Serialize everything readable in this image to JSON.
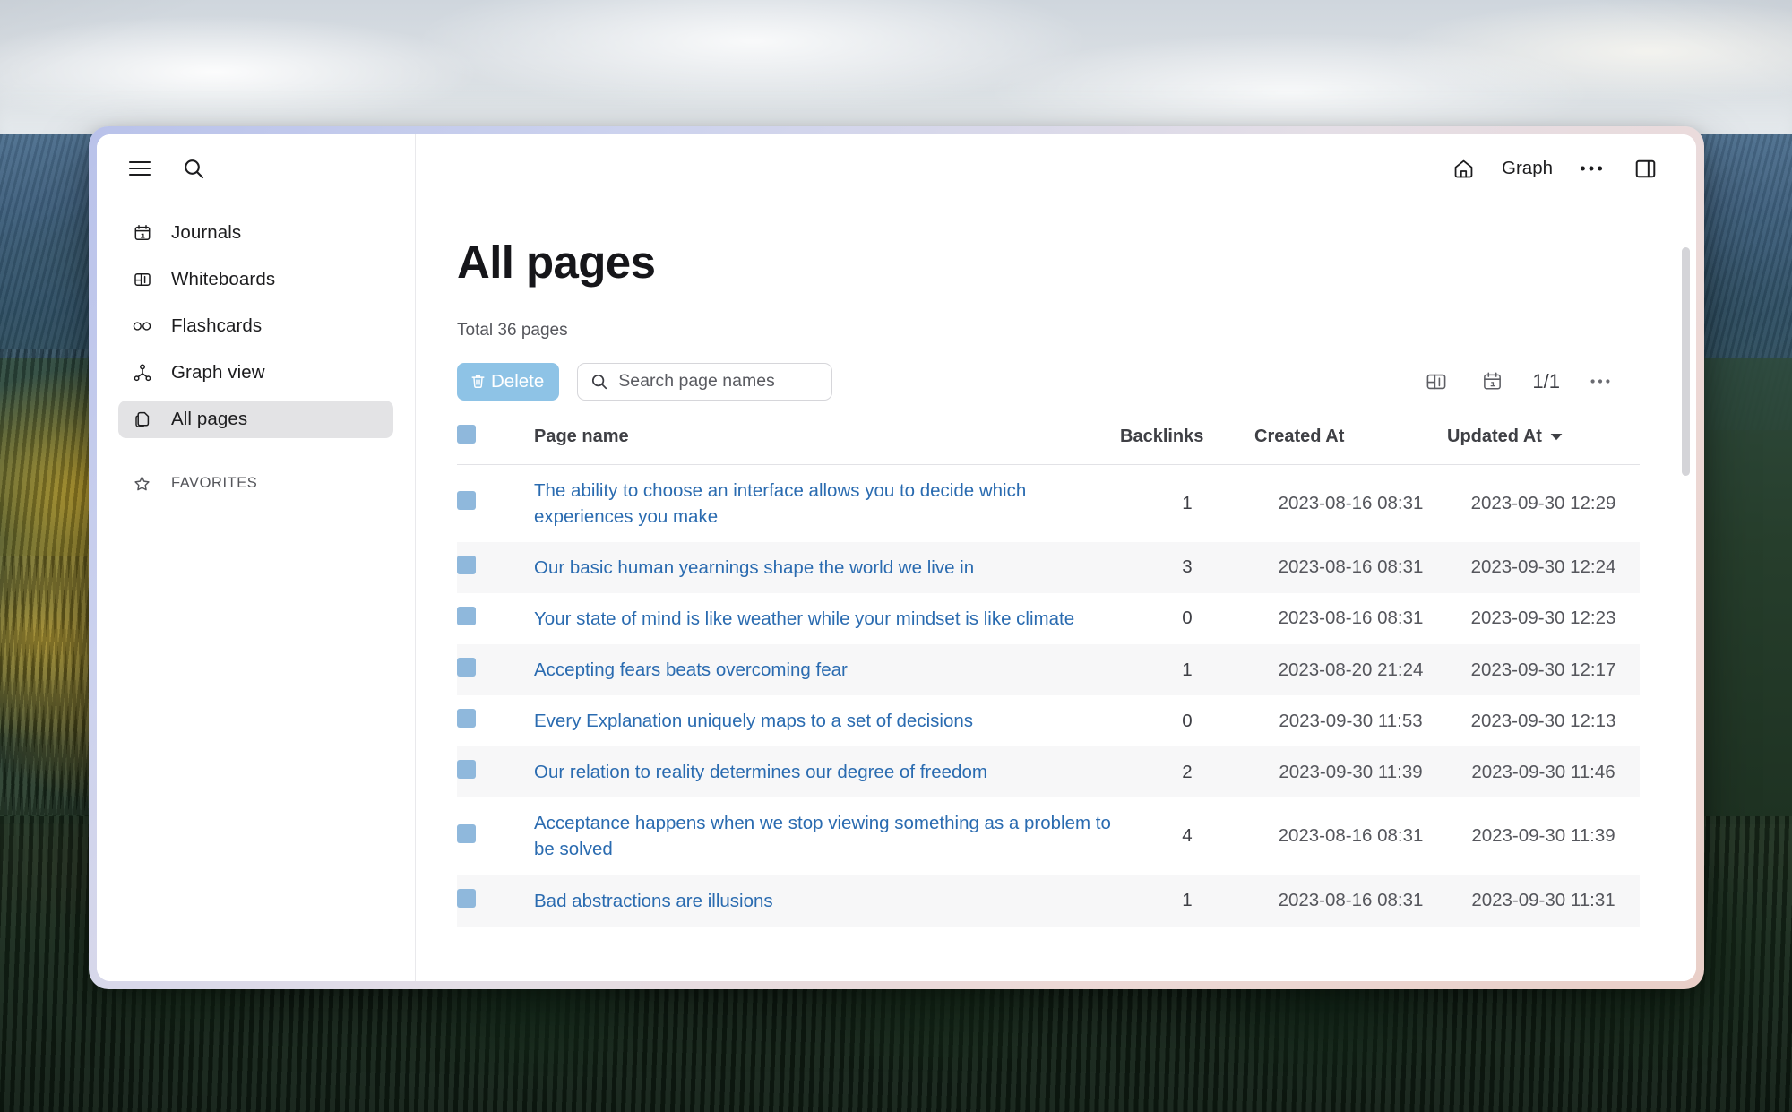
{
  "sidebar": {
    "menu_icon": "hamburger-menu-icon",
    "search_icon": "search-icon",
    "items": [
      {
        "label": "Journals",
        "icon": "calendar-icon",
        "active": false
      },
      {
        "label": "Whiteboards",
        "icon": "whiteboard-icon",
        "active": false
      },
      {
        "label": "Flashcards",
        "icon": "infinity-icon",
        "active": false
      },
      {
        "label": "Graph view",
        "icon": "graph-icon",
        "active": false
      },
      {
        "label": "All pages",
        "icon": "pages-icon",
        "active": true
      }
    ],
    "favorites_label": "FAVORITES",
    "favorites_icon": "star-icon"
  },
  "header": {
    "home_icon": "home-icon",
    "graph_label": "Graph",
    "more_icon": "ellipsis-icon",
    "right_sidebar_icon": "right-sidebar-toggle-icon"
  },
  "main": {
    "title": "All pages",
    "total": "Total 36 pages"
  },
  "toolbar": {
    "delete_label": "Delete",
    "delete_icon": "trash-icon",
    "delete_color": "#8ec3e6",
    "search_placeholder": "Search page names",
    "search_value": "",
    "search_icon": "search-icon",
    "whiteboard_icon": "whiteboard-icon",
    "calendar_icon": "calendar-icon",
    "pagination": "1/1",
    "more_icon": "ellipsis-icon"
  },
  "table": {
    "columns": {
      "page_name": "Page name",
      "backlinks": "Backlinks",
      "created_at": "Created At",
      "updated_at": "Updated At"
    },
    "sort_column": "Updated At",
    "sort_direction": "desc",
    "sort_icon": "chevron-down-icon",
    "checkbox_color": "#8fb8dc",
    "link_color": "#2a6bb0",
    "rows": [
      {
        "name": "The ability to choose an interface allows you to decide which experiences you make",
        "backlinks": "1",
        "created_at": "2023-08-16 08:31",
        "updated_at": "2023-09-30 12:29"
      },
      {
        "name": "Our basic human yearnings shape the world we live in",
        "backlinks": "3",
        "created_at": "2023-08-16 08:31",
        "updated_at": "2023-09-30 12:24"
      },
      {
        "name": "Your state of mind is like weather while your mindset is like climate",
        "backlinks": "0",
        "created_at": "2023-08-16 08:31",
        "updated_at": "2023-09-30 12:23"
      },
      {
        "name": "Accepting fears beats overcoming fear",
        "backlinks": "1",
        "created_at": "2023-08-20 21:24",
        "updated_at": "2023-09-30 12:17"
      },
      {
        "name": "Every Explanation uniquely maps to a set of decisions",
        "backlinks": "0",
        "created_at": "2023-09-30 11:53",
        "updated_at": "2023-09-30 12:13"
      },
      {
        "name": "Our relation to reality determines our degree of freedom",
        "backlinks": "2",
        "created_at": "2023-09-30 11:39",
        "updated_at": "2023-09-30 11:46"
      },
      {
        "name": "Acceptance happens when we stop viewing something as a problem to be solved",
        "backlinks": "4",
        "created_at": "2023-08-16 08:31",
        "updated_at": "2023-09-30 11:39"
      },
      {
        "name": "Bad abstractions are illusions",
        "backlinks": "1",
        "created_at": "2023-08-16 08:31",
        "updated_at": "2023-09-30 11:31"
      }
    ]
  }
}
